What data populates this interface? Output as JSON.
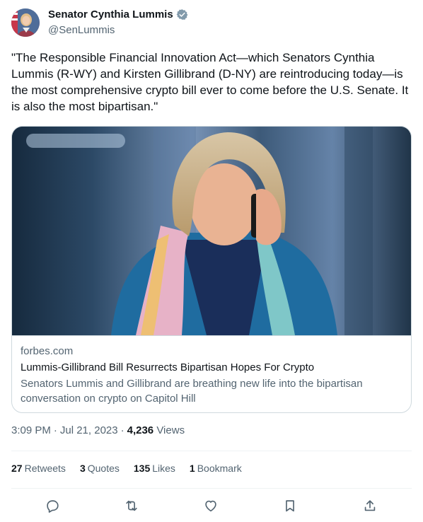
{
  "author": {
    "name": "Senator Cynthia Lummis",
    "handle": "@SenLummis",
    "verified_icon": "verified-badge-icon"
  },
  "tweet": {
    "text": "\"The Responsible Financial Innovation Act—which Senators Cynthia Lummis (R-WY) and Kirsten Gillibrand (D-NY) are reintroducing today—is the most comprehensive crypto bill ever to come before the U.S. Senate. It is also the most bipartisan.\""
  },
  "card": {
    "domain": "forbes.com",
    "title": "Lummis-Gillibrand Bill Resurrects Bipartisan Hopes For Crypto",
    "description": "Senators Lummis and Gillibrand are breathing new life into the bipartisan conversation on crypto on Capitol Hill"
  },
  "meta": {
    "time": "3:09 PM",
    "date": "Jul 21, 2023",
    "views_count": "4,236",
    "views_label": "Views"
  },
  "stats": {
    "retweets_count": "27",
    "retweets_label": "Retweets",
    "quotes_count": "3",
    "quotes_label": "Quotes",
    "likes_count": "135",
    "likes_label": "Likes",
    "bookmarks_count": "1",
    "bookmarks_label": "Bookmark"
  },
  "actions": [
    "reply-icon",
    "retweet-icon",
    "like-icon",
    "bookmark-icon",
    "share-icon"
  ],
  "colors": {
    "text_primary": "#0f1419",
    "text_secondary": "#536471",
    "border": "#cfd9de",
    "verified": "#829aab"
  }
}
